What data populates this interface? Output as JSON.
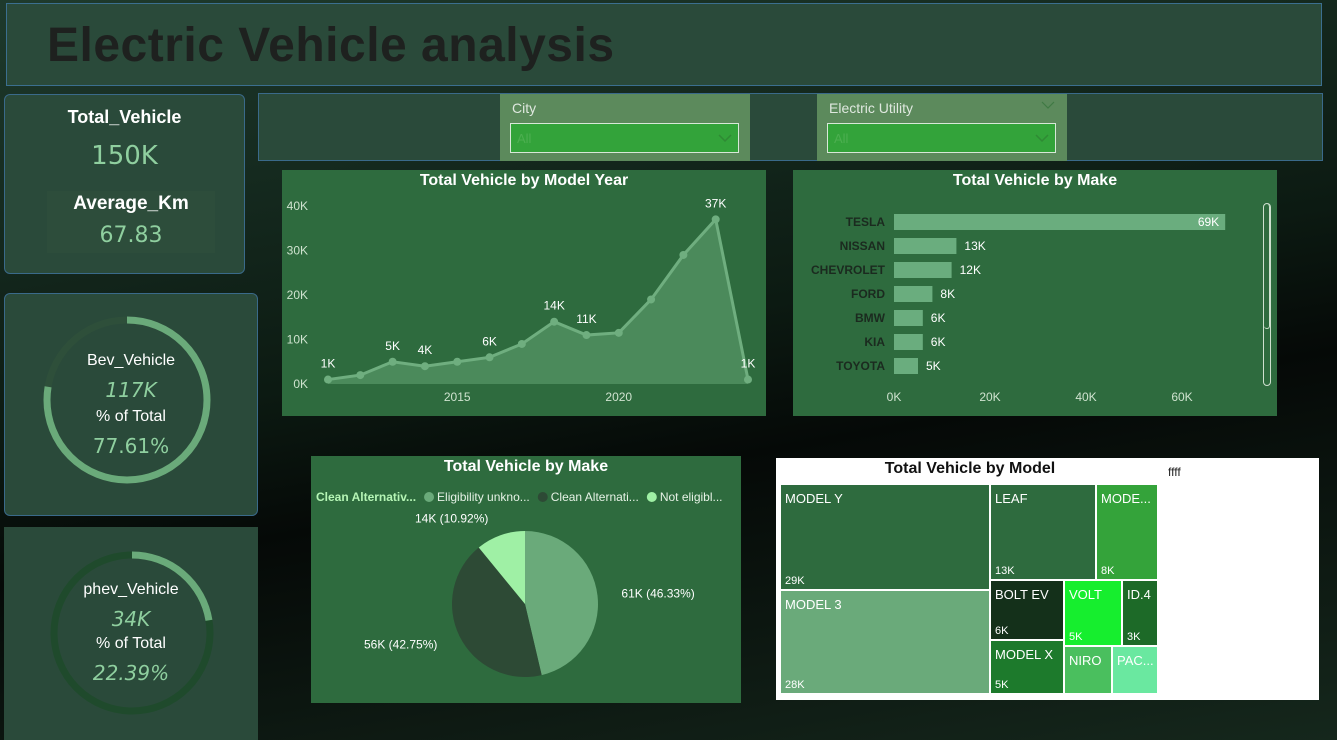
{
  "page": {
    "title": "Electric Vehicle analysis"
  },
  "kpi_total": {
    "label": "Total_Vehicle",
    "value": "150K"
  },
  "kpi_avg": {
    "label": "Average_Km",
    "value": "67.83"
  },
  "kpi_bev": {
    "label": "Bev_Vehicle",
    "value": "117K",
    "pct_label": "% of Total",
    "pct_value": "77.61%",
    "pct": 77.61
  },
  "kpi_phev": {
    "label": "phev_Vehicle",
    "value": "34K",
    "pct_label": "% of Total",
    "pct_value": "22.39%",
    "pct": 22.39
  },
  "filters": {
    "city": {
      "label": "City",
      "value": "All"
    },
    "utility": {
      "label": "Electric Utility",
      "value": "All"
    }
  },
  "colors": {
    "accent": "#33a33a",
    "panel": "#2e6b3e",
    "line": "#6fae7f",
    "bar": "#6aad7e"
  },
  "chart_data": [
    {
      "type": "area",
      "title": "Total Vehicle by Model Year",
      "x": [
        2011,
        2012,
        2013,
        2014,
        2015,
        2016,
        2017,
        2018,
        2019,
        2020,
        2021,
        2022,
        2023,
        2024
      ],
      "values": [
        1,
        2,
        5,
        4,
        5,
        6,
        9,
        14,
        11,
        11.5,
        19,
        29,
        37,
        1
      ],
      "data_labels": [
        {
          "x": 2011,
          "text": "1K"
        },
        {
          "x": 2013,
          "text": "5K"
        },
        {
          "x": 2014,
          "text": "4K"
        },
        {
          "x": 2016,
          "text": "6K"
        },
        {
          "x": 2018,
          "text": "14K"
        },
        {
          "x": 2019,
          "text": "11K"
        },
        {
          "x": 2023,
          "text": "37K"
        },
        {
          "x": 2024,
          "text": "1K"
        }
      ],
      "xticks": [
        "2015",
        "2020"
      ],
      "yticks": [
        "0K",
        "10K",
        "20K",
        "30K",
        "40K"
      ],
      "ylim": [
        0,
        40
      ]
    },
    {
      "type": "bar",
      "title": "Total Vehicle by Make",
      "categories": [
        "TESLA",
        "NISSAN",
        "CHEVROLET",
        "FORD",
        "BMW",
        "KIA",
        "TOYOTA"
      ],
      "values": [
        69,
        13,
        12,
        8,
        6,
        6,
        5
      ],
      "labels": [
        "69K",
        "13K",
        "12K",
        "8K",
        "6K",
        "6K",
        "5K"
      ],
      "xticks": [
        "0K",
        "20K",
        "40K",
        "60K"
      ],
      "xlim": [
        0,
        70
      ]
    },
    {
      "type": "pie",
      "title": "Total Vehicle by Make",
      "legend": [
        {
          "label": "Clean Alternativ...",
          "color": "#b5f5b5"
        },
        {
          "label": "Eligibility unkno...",
          "color": "#6aaa7a"
        },
        {
          "label": "Clean Alternati...",
          "color": "#2d4a35"
        },
        {
          "label": "Not eligibl...",
          "color": "#9ff0a5"
        }
      ],
      "slices": [
        {
          "value": 46.33,
          "label": "61K (46.33%)",
          "color": "#6aaa7a"
        },
        {
          "value": 42.75,
          "label": "56K (42.75%)",
          "color": "#2d4a35"
        },
        {
          "value": 10.92,
          "label": "14K (10.92%)",
          "color": "#9ff0a5"
        }
      ]
    },
    {
      "type": "treemap",
      "title": "Total Vehicle by Model",
      "cells": [
        {
          "name": "MODEL Y",
          "value": "29K"
        },
        {
          "name": "MODEL 3",
          "value": "28K"
        },
        {
          "name": "LEAF",
          "value": "13K"
        },
        {
          "name": "MODE...",
          "value": "8K"
        },
        {
          "name": "BOLT EV",
          "value": "6K"
        },
        {
          "name": "VOLT",
          "value": "5K"
        },
        {
          "name": "ID.4",
          "value": "3K"
        },
        {
          "name": "MODEL X",
          "value": "5K"
        },
        {
          "name": "NIRO",
          "value": ""
        },
        {
          "name": "PAC...",
          "value": ""
        }
      ],
      "note": "ffff"
    }
  ]
}
